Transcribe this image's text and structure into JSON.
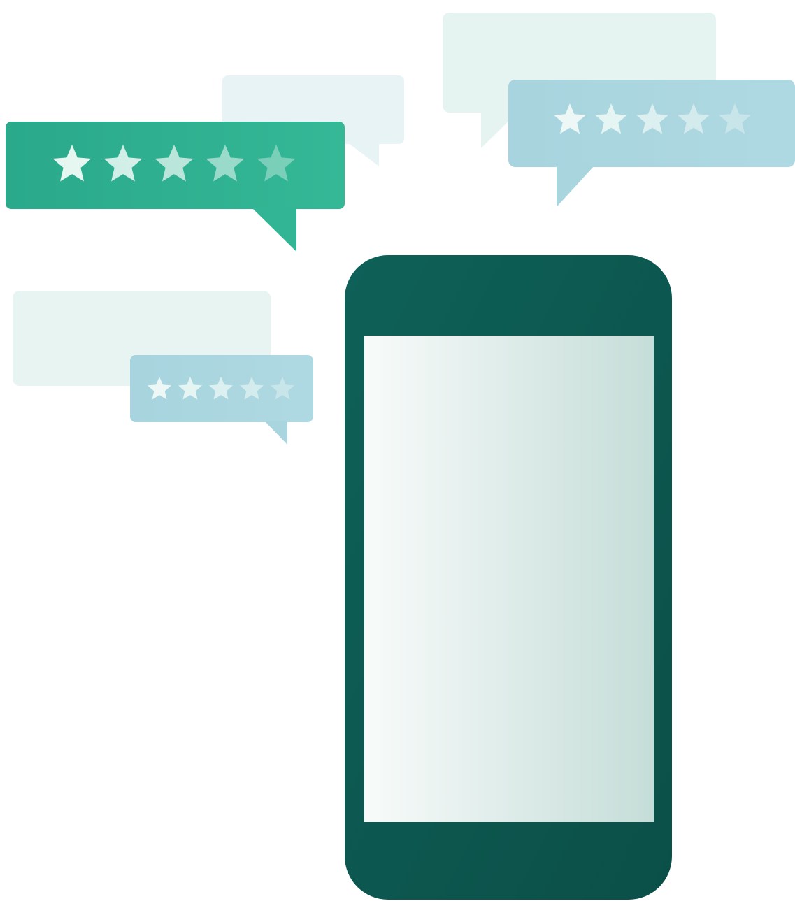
{
  "colors": {
    "background": "#ffffff",
    "primary_green": "#2fb392",
    "light_blue": "#a9d6df",
    "pale_green": "#e6f4f1",
    "pale_blue": "#e8f3f5",
    "phone_body_dark": "#0b534c",
    "phone_body_mid": "#0e6158",
    "phone_screen_light": "#f8fbfa",
    "phone_screen_shade": "#c5ddd8",
    "star_fill": "#f0faf7"
  },
  "review_bubbles": [
    {
      "id": "green-large",
      "color": "primary_green",
      "rating": 5
    },
    {
      "id": "blue-right",
      "color": "light_blue",
      "rating": 5
    },
    {
      "id": "blue-small",
      "color": "light_blue",
      "rating": 5
    }
  ],
  "background_bubbles": [
    "pale_blue",
    "pale_green",
    "pale_green"
  ],
  "icons": [
    "star-icon",
    "phone-icon",
    "speech-bubble-icon"
  ]
}
